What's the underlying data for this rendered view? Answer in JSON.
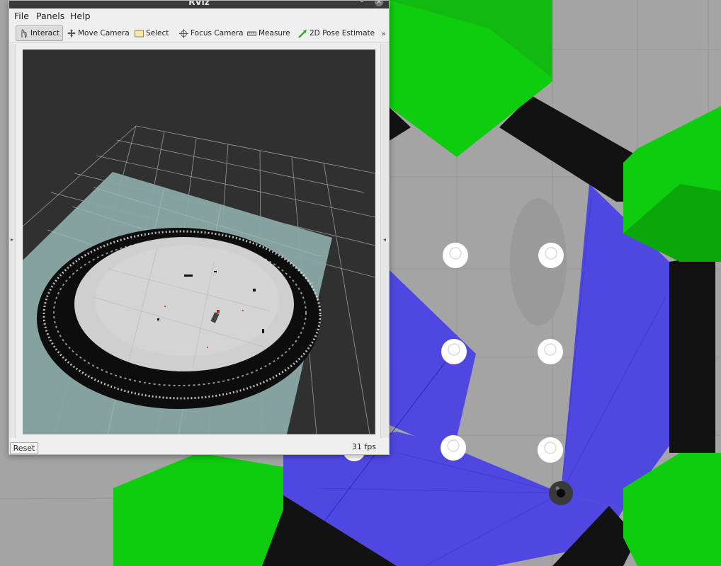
{
  "window": {
    "title": "RViz"
  },
  "menu": {
    "file": "File",
    "panels": "Panels",
    "help": "Help"
  },
  "toolbar": {
    "interact": "Interact",
    "move_camera": "Move Camera",
    "select": "Select",
    "focus_camera": "Focus Camera",
    "measure": "Measure",
    "pose_estimate": "2D Pose Estimate",
    "more": "»"
  },
  "statusbar": {
    "reset": "Reset",
    "fps": "31 fps"
  },
  "colors": {
    "scan_blue": "#4b43e4",
    "obstacle_green": "#0ecc0e",
    "wall_black": "#111111",
    "ground_gray": "#a3a3a3",
    "viewport_bg": "#303030",
    "map_teal": "#8aa8a6",
    "grid_line": "#b5b5b5"
  },
  "icons": {
    "interact": "hand-pointer-icon",
    "move_camera": "move-arrows-icon",
    "select": "selection-rect-icon",
    "focus_camera": "crosshair-icon",
    "measure": "ruler-icon",
    "pose_estimate": "green-arrow-icon"
  }
}
